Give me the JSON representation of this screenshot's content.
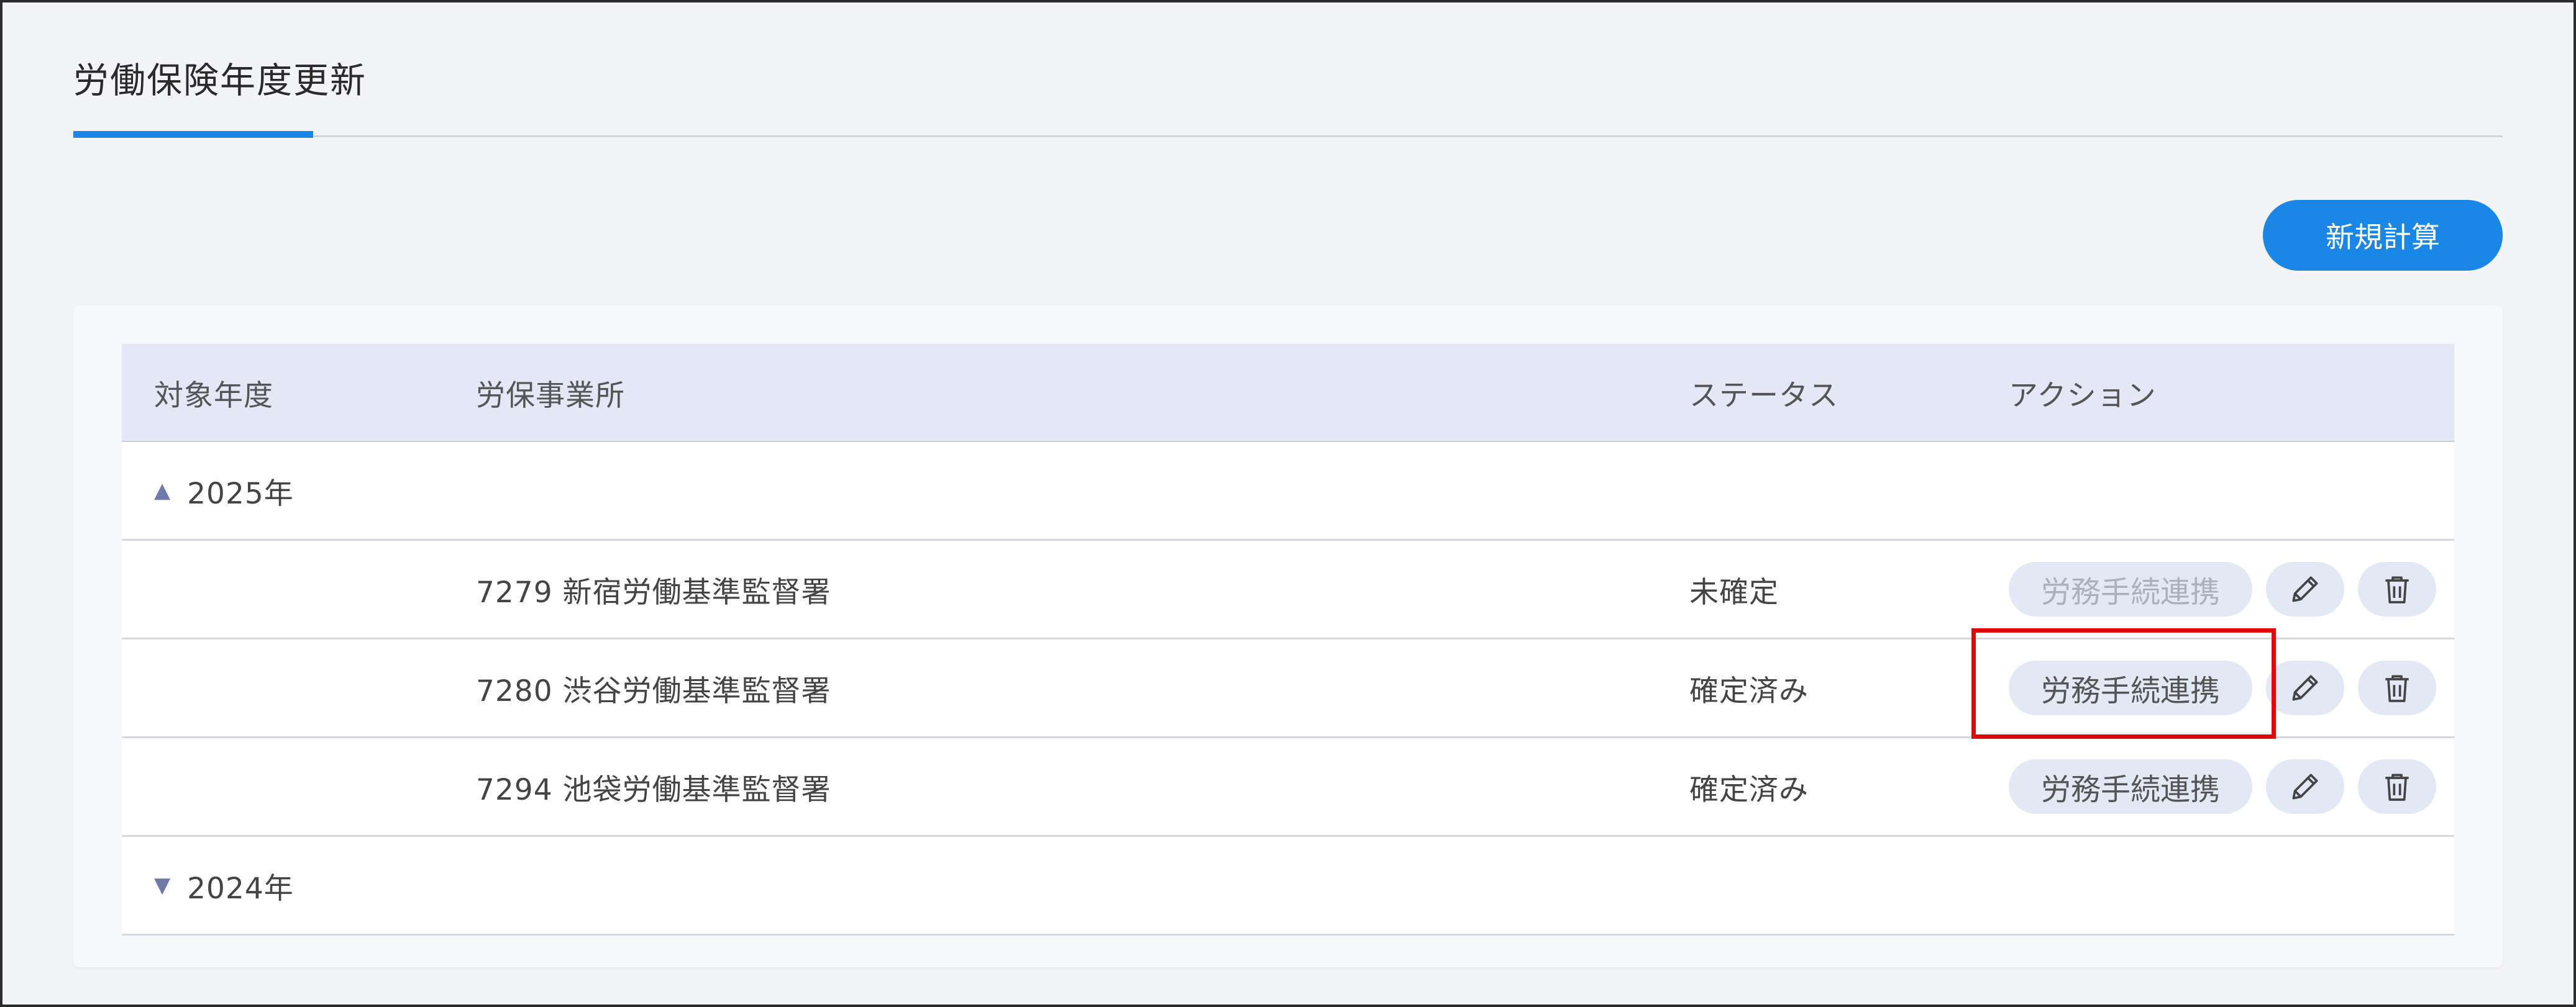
{
  "page": {
    "title": "労働保険年度更新"
  },
  "toolbar": {
    "new_calc_label": "新規計算"
  },
  "table": {
    "headers": {
      "year": "対象年度",
      "office": "労保事業所",
      "status": "ステータス",
      "action": "アクション"
    },
    "groups": [
      {
        "year_label": "2025年",
        "expanded": true
      },
      {
        "year_label": "2024年",
        "expanded": false
      }
    ],
    "rows": [
      {
        "office": "7279 新宿労働基準監督署",
        "status": "未確定",
        "link_label": "労務手続連携",
        "link_enabled": false
      },
      {
        "office": "7280 渋谷労働基準監督署",
        "status": "確定済み",
        "link_label": "労務手続連携",
        "link_enabled": true
      },
      {
        "office": "7294 池袋労働基準監督署",
        "status": "確定済み",
        "link_label": "労務手続連携",
        "link_enabled": true
      }
    ]
  },
  "colors": {
    "accent": "#1a87e6",
    "header_bg": "#e3e7f6",
    "highlight": "#e10a0a"
  },
  "icons": {
    "expanded": "triangle-up-icon",
    "collapsed": "triangle-down-icon",
    "edit": "pencil-icon",
    "delete": "trash-icon"
  }
}
